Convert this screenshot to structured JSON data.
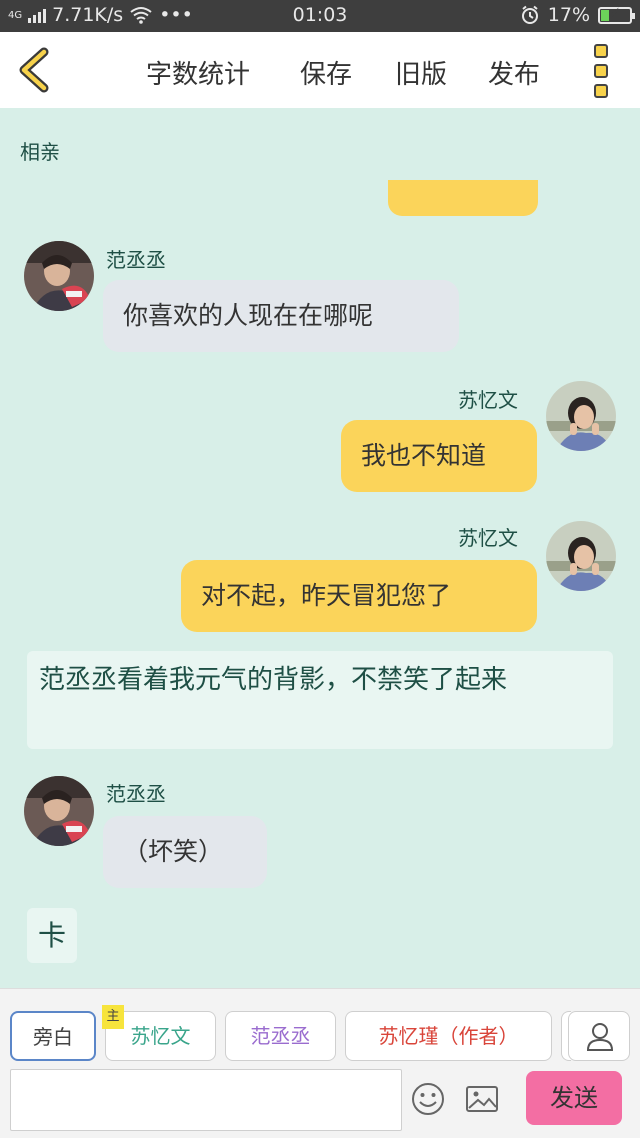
{
  "status_bar": {
    "network": "4G",
    "speed": "7.71K/s",
    "dots": "•••",
    "time": "01:03",
    "battery": "17%",
    "alarm_icon": "alarm-icon"
  },
  "toolbar": {
    "word_count": "字数统计",
    "save": "保存",
    "old_version": "旧版",
    "publish": "发布"
  },
  "chat": {
    "title": "相亲",
    "messages": [
      {
        "side": "left",
        "name": "范丞丞",
        "text": "你喜欢的人现在在哪呢"
      },
      {
        "side": "right",
        "name": "苏忆文",
        "text": "我也不知道"
      },
      {
        "side": "right",
        "name": "苏忆文",
        "text": "对不起，昨天冒犯您了"
      },
      {
        "side": "center",
        "text": "范丞丞看着我元气的背影，不禁笑了起来"
      },
      {
        "side": "left",
        "name": "范丞丞",
        "text": "（坏笑）"
      },
      {
        "side": "center",
        "text": "卡"
      }
    ]
  },
  "roles": {
    "narrator": "旁白",
    "main_tag": "主",
    "role1": "苏忆文",
    "role2": "范丞丞",
    "role3": "苏忆瑾（作者）"
  },
  "composer": {
    "placeholder": "",
    "send": "发送"
  },
  "colors": {
    "background": "#d8efe8",
    "bubble_yellow": "#fbd45a",
    "bubble_gray": "#e3e7ec",
    "send_pink": "#f36ea3",
    "role1_color": "#3aa58b",
    "role2_color": "#9a6ccf",
    "role3_color": "#d9453a"
  }
}
